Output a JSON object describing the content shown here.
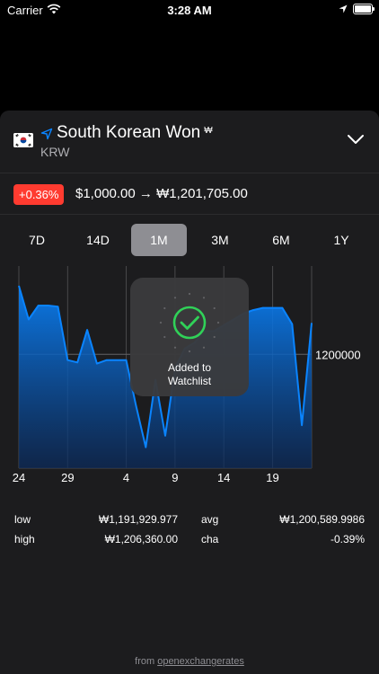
{
  "status_bar": {
    "carrier": "Carrier",
    "time": "3:28 AM"
  },
  "header": {
    "currency_name": "South Korean Won",
    "currency_symbol": "₩",
    "currency_code": "KRW"
  },
  "rate": {
    "change": "+0.36%",
    "conversion": "$1,000.00 → ₩1,201,705.00"
  },
  "tabs": [
    {
      "label": "7D"
    },
    {
      "label": "14D"
    },
    {
      "label": "1M",
      "active": true
    },
    {
      "label": "3M"
    },
    {
      "label": "6M"
    },
    {
      "label": "1Y"
    }
  ],
  "chart_data": {
    "type": "area",
    "x": [
      "24",
      "25",
      "26",
      "27",
      "28",
      "29",
      "30",
      "31",
      "1",
      "2",
      "3",
      "4",
      "5",
      "6",
      "7",
      "8",
      "9",
      "10",
      "11",
      "12",
      "13",
      "14",
      "15",
      "16",
      "17",
      "18",
      "19",
      "20",
      "21",
      "22",
      "23"
    ],
    "values": [
      1205900,
      1203000,
      1204200,
      1204200,
      1204100,
      1199500,
      1199300,
      1202100,
      1199200,
      1199500,
      1199500,
      1199500,
      1195600,
      1192000,
      1197800,
      1193000,
      1198800,
      1200500,
      1201000,
      1202000,
      1202000,
      1202500,
      1203000,
      1203500,
      1203800,
      1204000,
      1204000,
      1204000,
      1202600,
      1193900,
      1202700
    ],
    "x_ticks": [
      "24",
      "29",
      "4",
      "9",
      "14",
      "19"
    ],
    "y_ticks": [
      "1200000"
    ],
    "y_tick_values": [
      1200000
    ],
    "ylim": [
      1190200,
      1207600
    ],
    "line_color": "#0a84ff",
    "grid": true
  },
  "stats": {
    "low_label": "low",
    "low_value": "₩1,191,929.977",
    "avg_label": "avg",
    "avg_value": "₩1,200,589.9986",
    "high_label": "high",
    "high_value": "₩1,206,360.00",
    "cha_label": "cha",
    "cha_value": "-0.39%"
  },
  "footer": {
    "prefix": "from",
    "link": "openexchangerates"
  },
  "toast": {
    "line1": "Added to",
    "line2": "Watchlist"
  },
  "colors": {
    "accent": "#0a84ff",
    "badge": "#ff3b30",
    "success": "#30d158",
    "card": "#1c1c1e"
  }
}
